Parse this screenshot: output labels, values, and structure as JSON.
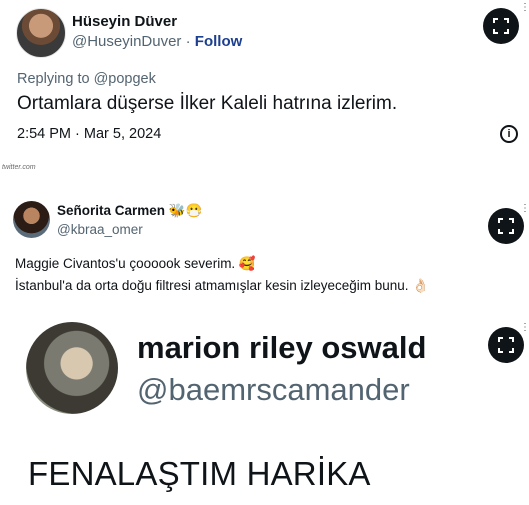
{
  "tweets": [
    {
      "display_name": "Hüseyin Düver",
      "handle": "@HuseyinDuver",
      "separator": "·",
      "follow_label": "Follow",
      "replying_to": "Replying to @popgek",
      "text": "Ortamlara düşerse İlker Kaleli hatrına izlerim.",
      "timestamp": "2:54 PM · Mar 5, 2024",
      "info_icon": "info-circle-icon",
      "source_caption": "twitter.com"
    },
    {
      "display_name": "Señorita Carmen",
      "name_emoji": "🐝😷",
      "handle": "@kbraa_omer",
      "line1": "Maggie Civantos'u çoooook severim. 🥰",
      "line2": "İstanbul'a da orta doğu filtresi atmamışlar kesin izleyeceğim bunu. 👌🏻"
    },
    {
      "display_name": "marion riley oswald",
      "handle": "@baemrscamander",
      "text": "FENALAŞTIM HARİKA"
    }
  ],
  "overlay": {
    "expand_icon": "expand-icon",
    "more_icon": "more-dots-icon",
    "more_glyph": "⋮"
  }
}
